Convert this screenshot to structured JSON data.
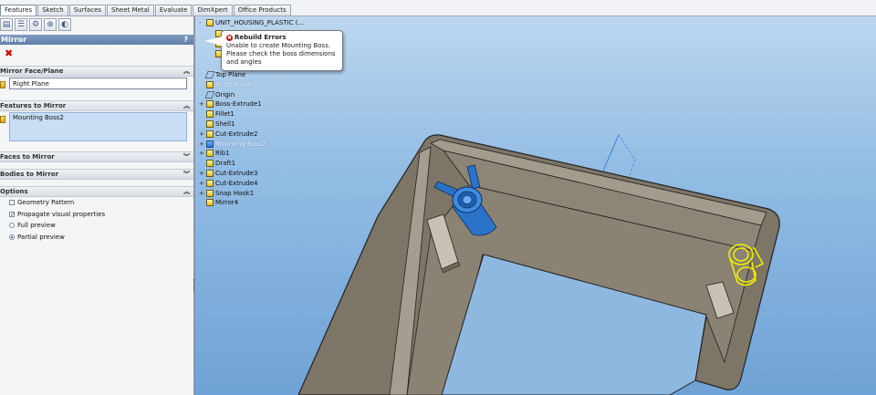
{
  "tabs": [
    "Features",
    "Sketch",
    "Surfaces",
    "Sheet Metal",
    "Evaluate",
    "DimXpert",
    "Office Products"
  ],
  "panel": {
    "icons": [
      "feature-manager-icon",
      "property-manager-icon",
      "configuration-manager-icon",
      "dimxpert-manager-icon",
      "display-manager-icon"
    ],
    "title": "Mirror",
    "help": "?",
    "cancel_glyph": "✖",
    "sections": {
      "mirror_face": "Mirror Face/Plane",
      "features": "Features to Mirror",
      "faces": "Faces to Mirror",
      "bodies": "Bodies to Mirror",
      "options": "Options"
    },
    "mirror_face_value": "Right Plane",
    "features_value": "Mounting Boss2",
    "options": [
      {
        "label": "Geometry Pattern",
        "checked": false
      },
      {
        "label": "Propagate visual properties",
        "checked": true
      }
    ],
    "radios": [
      {
        "label": "Full preview",
        "on": false
      },
      {
        "label": "Partial preview",
        "on": true
      }
    ]
  },
  "tree": {
    "root": "UNIT_HOUSING_PLASTIC  (...",
    "items": [
      {
        "label": "Top Plane",
        "kind": "plane",
        "expand": ""
      },
      {
        "label": "Right Plane",
        "kind": "sel",
        "expand": ""
      },
      {
        "label": "Origin",
        "kind": "plane",
        "expand": ""
      },
      {
        "label": "Boss-Extrude1",
        "kind": "",
        "expand": "+"
      },
      {
        "label": "Fillet1",
        "kind": "",
        "expand": ""
      },
      {
        "label": "Shell1",
        "kind": "",
        "expand": ""
      },
      {
        "label": "Cut-Extrude2",
        "kind": "",
        "expand": "+"
      },
      {
        "label": "Mounting Boss2",
        "kind": "warn",
        "expand": "+"
      },
      {
        "label": "Rib1",
        "kind": "",
        "expand": "+"
      },
      {
        "label": "Draft1",
        "kind": "",
        "expand": ""
      },
      {
        "label": "Cut-Extrude3",
        "kind": "",
        "expand": "+"
      },
      {
        "label": "Cut-Extrude4",
        "kind": "",
        "expand": "+"
      },
      {
        "label": "Snap Hook1",
        "kind": "",
        "expand": "+"
      },
      {
        "label": "Mirror4",
        "kind": "",
        "expand": ""
      }
    ]
  },
  "tooltip": {
    "title": "Rebuild Errors",
    "message": "Unable to create Mounting Boss. Please check the boss dimensions and angles"
  },
  "view_toolbar": [
    "zoom-fit-icon",
    "zoom-area-icon",
    "previous-view-icon",
    "section-view-icon",
    "view-orientation-icon",
    "display-style-icon",
    "hide-show-icon",
    "edit-appearance-icon",
    "scene-icon",
    "view-settings-icon"
  ],
  "colors": {
    "viewport_top": "#bdd6ef",
    "viewport_bottom": "#6fa2d6",
    "part_body": "#7d7566",
    "boss_blue": "#2b73c9",
    "preview_yellow": "#f2ee00",
    "panel_title": "#6a89b2",
    "error_red": "#d60000"
  }
}
